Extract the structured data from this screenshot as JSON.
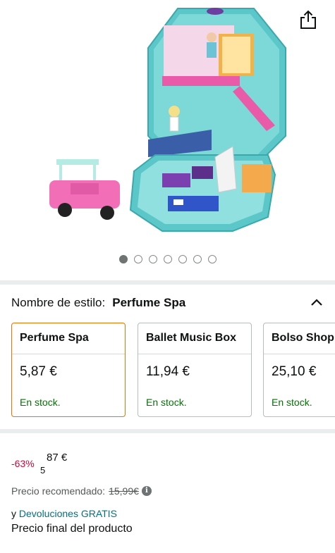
{
  "gallery": {
    "image_count": 7,
    "active_index": 0
  },
  "style_selector": {
    "label": "Nombre de estilo:",
    "selected": "Perfume Spa"
  },
  "variants": [
    {
      "name": "Perfume Spa",
      "price": "5,87 €",
      "stock": "En stock.",
      "selected": true
    },
    {
      "name": "Ballet Music Box",
      "price": "11,94 €",
      "stock": "En stock.",
      "selected": false
    },
    {
      "name": "Bolso Shop",
      "price": "25,10 €",
      "stock": "En stock.",
      "selected": false
    }
  ],
  "pricing": {
    "discount": "-63%",
    "price_whole": "5",
    "price_fraction": "87 €",
    "rrp_label": "Precio recomendado:",
    "rrp_value": "15,99€",
    "returns_prefix": "y",
    "returns_link": "Devoluciones GRATIS",
    "final_price_label": "Precio final del producto"
  },
  "colors": {
    "stock_green": "#007600",
    "discount_red": "#cc0c39",
    "link_teal": "#007185",
    "selected_border": "#e77600"
  },
  "icons": [
    "share-icon",
    "chevron-up-icon",
    "info-icon"
  ]
}
